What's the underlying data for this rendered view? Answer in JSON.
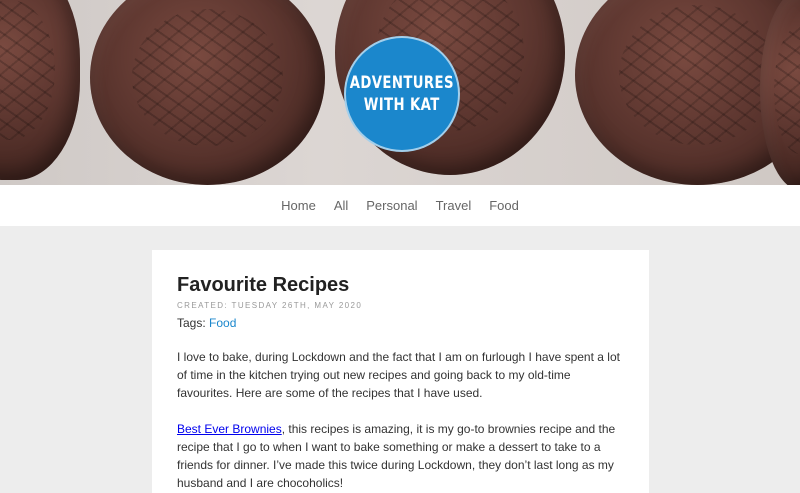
{
  "logo": {
    "line1": "ADVENTURES",
    "line2": "WITH KAT"
  },
  "nav": [
    "Home",
    "All",
    "Personal",
    "Travel",
    "Food"
  ],
  "post": {
    "title": "Favourite Recipes",
    "created": "CREATED: TUESDAY 26TH, MAY 2020",
    "tags_label": "Tags:",
    "tag": "Food",
    "paragraph1": "I love to bake, during Lockdown and the fact that I am on furlough I have spent a lot of time in the kitchen trying out new recipes and going back to my old-time favourites. Here are some of the recipes that I have used.",
    "link_text": "Best Ever Brownies",
    "paragraph2_rest": ", this recipes is amazing, it is my go-to brownies recipe and the recipe that I go to when I want to bake something or make a dessert to take to a friends for dinner. I’ve made this twice during Lockdown, they don’t last long as my husband and I are chocoholics!"
  },
  "colors": {
    "accent": "#1b87cc",
    "background": "#ededed"
  }
}
